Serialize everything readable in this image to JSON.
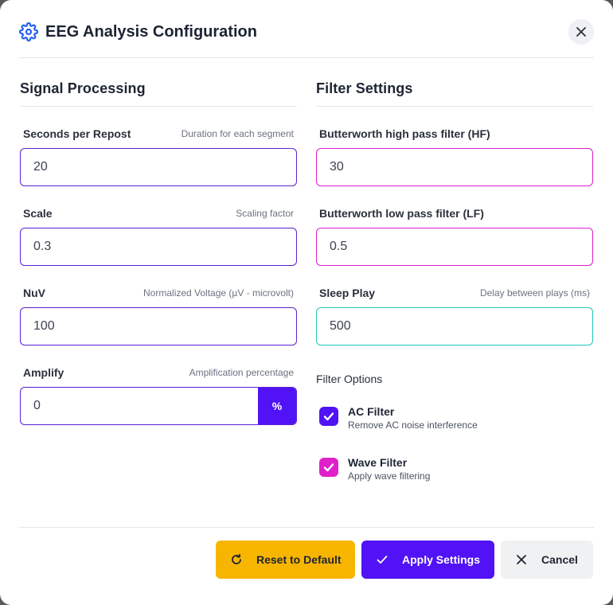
{
  "dialog": {
    "title": "EEG Analysis Configuration",
    "icon": "gear-icon",
    "accent": "#2563eb"
  },
  "signal_processing": {
    "title": "Signal Processing",
    "fields": [
      {
        "label": "Seconds per Repost",
        "hint": "Duration for each segment",
        "value": "20"
      },
      {
        "label": "Scale",
        "hint": "Scaling factor",
        "value": "0.3"
      },
      {
        "label": "NuV",
        "hint": "Normalized Voltage (µV - microvolt)",
        "value": "100"
      },
      {
        "label": "Amplify",
        "hint": "Amplification percentage",
        "value": "0",
        "unit": "%"
      }
    ]
  },
  "filter_settings": {
    "title": "Filter Settings",
    "fields": [
      {
        "label": "Butterworth high pass filter (HF)",
        "value": "30"
      },
      {
        "label": "Butterworth low pass filter (LF)",
        "value": "0.5"
      },
      {
        "label": "Sleep Play",
        "hint": "Delay between plays (ms)",
        "value": "500"
      }
    ],
    "options_title": "Filter Options",
    "options": [
      {
        "title": "AC Filter",
        "desc": "Remove AC noise interference",
        "checked": true,
        "color": "#5112f5"
      },
      {
        "title": "Wave Filter",
        "desc": "Apply wave filtering",
        "checked": true,
        "color": "#e020c8"
      }
    ]
  },
  "footer": {
    "reset_label": "Reset to Default",
    "apply_label": "Apply Settings",
    "cancel_label": "Cancel"
  },
  "colors": {
    "primary": "#5112f5",
    "pink": "#e020c8",
    "teal": "#22c6b8",
    "warning": "#f7b500"
  }
}
